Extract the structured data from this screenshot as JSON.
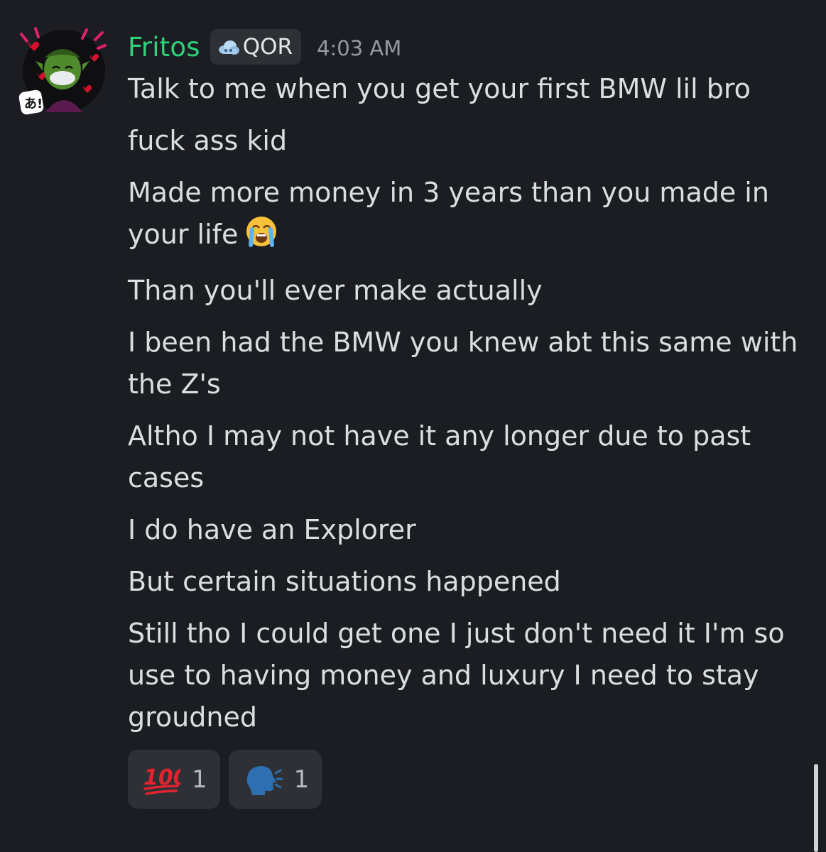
{
  "message_group": {
    "author": {
      "username": "Fritos",
      "tag": "QOR",
      "timestamp": "4:03 AM",
      "name_color": "#2fd17a",
      "tag_icon": "cloud-icon"
    },
    "messages": [
      {
        "text": "Talk to me when you get your first BMW lil bro"
      },
      {
        "text": "fuck ass kid"
      },
      {
        "text": "Made more money in 3 years than you made in your life",
        "emoji": "loudly-crying-face-icon"
      },
      {
        "text": "Than you'll ever make actually"
      },
      {
        "text": "I been had the BMW you knew abt this same with the Z's"
      },
      {
        "text": "Altho I may not have it any longer due to past cases"
      },
      {
        "text": "I do have an Explorer"
      },
      {
        "text": "But certain situations happened"
      },
      {
        "text": "Still tho I could get one I just don't need it I'm so use to having money and luxury I need to stay groudned"
      }
    ],
    "reactions": [
      {
        "emoji": "hundred-points-icon",
        "count": "1"
      },
      {
        "emoji": "speaking-head-icon",
        "count": "1"
      }
    ]
  },
  "theme": {
    "background": "#1c1d22",
    "text": "#dbdee1",
    "muted": "#949ba4",
    "chip": "#2e3036"
  }
}
